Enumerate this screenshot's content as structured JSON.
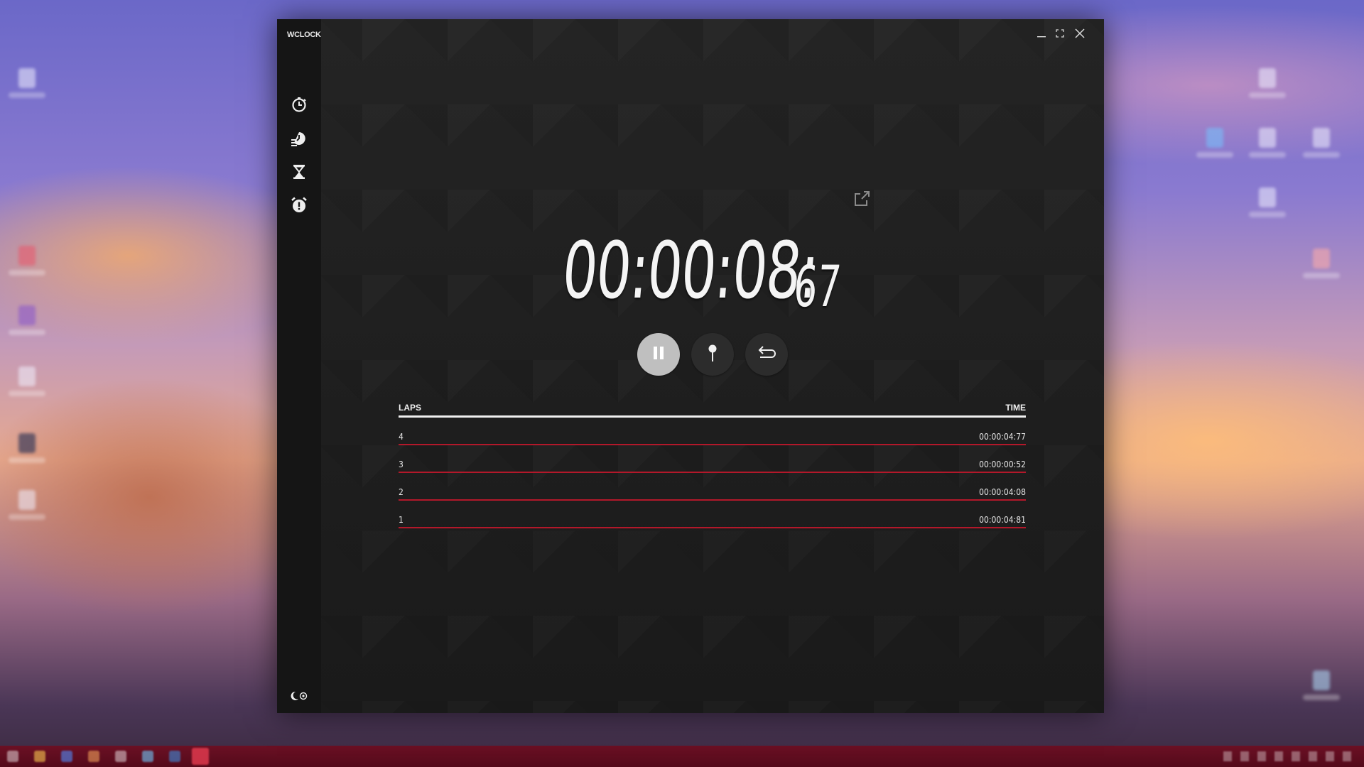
{
  "app": {
    "title": "WCLOCK"
  },
  "nav": {
    "items": [
      {
        "name": "stopwatch",
        "icon": "stopwatch-icon"
      },
      {
        "name": "world-clock",
        "icon": "world-clock-icon"
      },
      {
        "name": "timer",
        "icon": "hourglass-icon"
      },
      {
        "name": "alarm",
        "icon": "alarm-icon"
      }
    ],
    "theme_toggle_icon": "theme-toggle-icon"
  },
  "window_controls": [
    "minimize-icon",
    "maximize-icon",
    "close-icon"
  ],
  "stopwatch": {
    "main": "00:00:08:",
    "centiseconds": "67",
    "controls": [
      {
        "name": "pause",
        "icon": "pause-icon"
      },
      {
        "name": "lap",
        "icon": "pin-icon"
      },
      {
        "name": "reset",
        "icon": "reset-icon"
      }
    ]
  },
  "laps": {
    "header_left": "LAPS",
    "header_right": "TIME",
    "rows": [
      {
        "lap": "4",
        "time": "00:00:04:77"
      },
      {
        "lap": "3",
        "time": "00:00:00:52"
      },
      {
        "lap": "2",
        "time": "00:00:04:08"
      },
      {
        "lap": "1",
        "time": "00:00:04:81"
      }
    ]
  },
  "colors": {
    "window_bg": "#1f1f1f",
    "sidebar_bg": "#151515",
    "accent_red": "#b3182a",
    "taskbar": "#5e0c1f"
  }
}
